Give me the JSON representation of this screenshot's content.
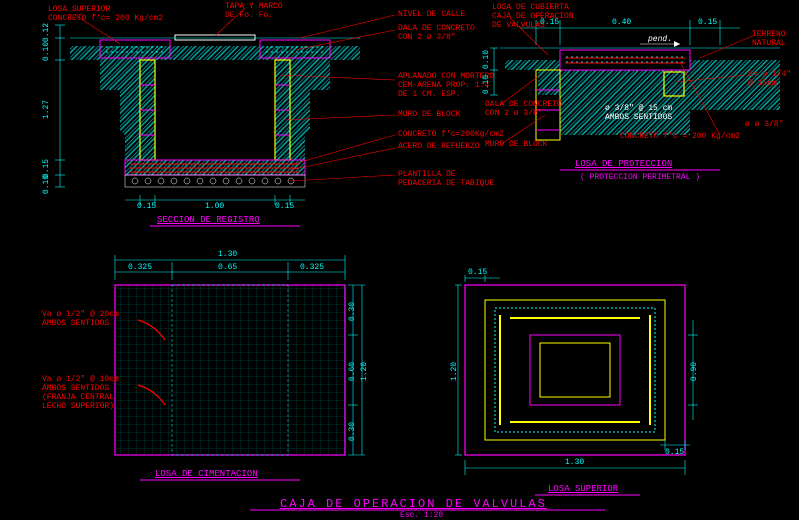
{
  "title": "CAJA DE OPERACION DE VALVULAS",
  "scale": "Esc. 1:20",
  "sections": {
    "s1": {
      "title": "SECCION DE REGISTRO",
      "dims": [
        "0.15",
        "1.00",
        "0.15",
        "0.12",
        "0.10",
        "1.27",
        "0.15",
        "0.10"
      ]
    },
    "s2": {
      "title": "LOSA DE PROTECCION",
      "sub": "( PROTECCION PERIMETRAL )",
      "dims": [
        "0.15",
        "0.40",
        "0.15",
        "0.10",
        "0.10"
      ]
    },
    "s3": {
      "title": "LOSA DE CIMENTACION",
      "dims": [
        "1.30",
        "0.325",
        "0.65",
        "0.325",
        "0.30",
        "0.60",
        "1.20",
        "0.30"
      ]
    },
    "s4": {
      "title": "LOSA SUPERIOR",
      "dims": [
        "0.15",
        "1.20",
        "0.90",
        "1.30",
        "0.15"
      ]
    }
  },
  "annotations": {
    "losa_sup": "LOSA SUPERIOR",
    "losa_sup2": "CONCRETO f'c= 200 Kg/cm2",
    "tapa": "TAPA Y MARCO",
    "tapa2": "DE Fo. Fo.",
    "nivel": "NIVEL DE CALLE",
    "dala": "DALA DE CONCRETO",
    "dala2": "CON  2 ø 3/8\"",
    "aplanado": "APLANADO CON MORTERO",
    "aplanado2": "CEM-ARENA PROP. 1:4",
    "aplanado3": "DE 1 CM. ESP.",
    "muro": "MURO DE BLOCK",
    "concreto": "CONCRETO f'c=200Kg/cm2",
    "acero": "ACERO DE REFUERZO",
    "plantilla": "PLANTILLA DE",
    "plantilla2": "PEDACERIA DE TABIQUE",
    "losa_cub": "LOSA DE CUBIERTA",
    "losa_cub2": "CAJA DE OPERACION",
    "losa_cub3": "DE VALVULAS",
    "terreno": "TERRENO",
    "terreno2": "NATURAL",
    "pend": "pend.",
    "e14": "E= ø 1/4\"",
    "e14b": "@ 15cm",
    "s2_dala": "DALA DE CONCRETO",
    "s2_dala2": "CON 2 ø 3/8\"",
    "s2_muro": "MURO DE BLOCK",
    "s2_conc": "CONCRETO f'c = 200 Kg/cm2",
    "s2_rebar": "ø 3/8\" @ 15 cm",
    "s2_rebar2": "AMBOS SENTIDOS",
    "s2_rebar3": "ø ø 3/8\"",
    "va20": "Va ø 1/2\" @ 20cm",
    "va20b": "AMBOS SENTIDOS",
    "va10": "Va ø 1/2\" @ 10cm",
    "va10b": "AMBOS SENTIDOS",
    "va10c": "(FRANJA CENTRAL",
    "va10d": "LECHO SUPERIOR)"
  }
}
